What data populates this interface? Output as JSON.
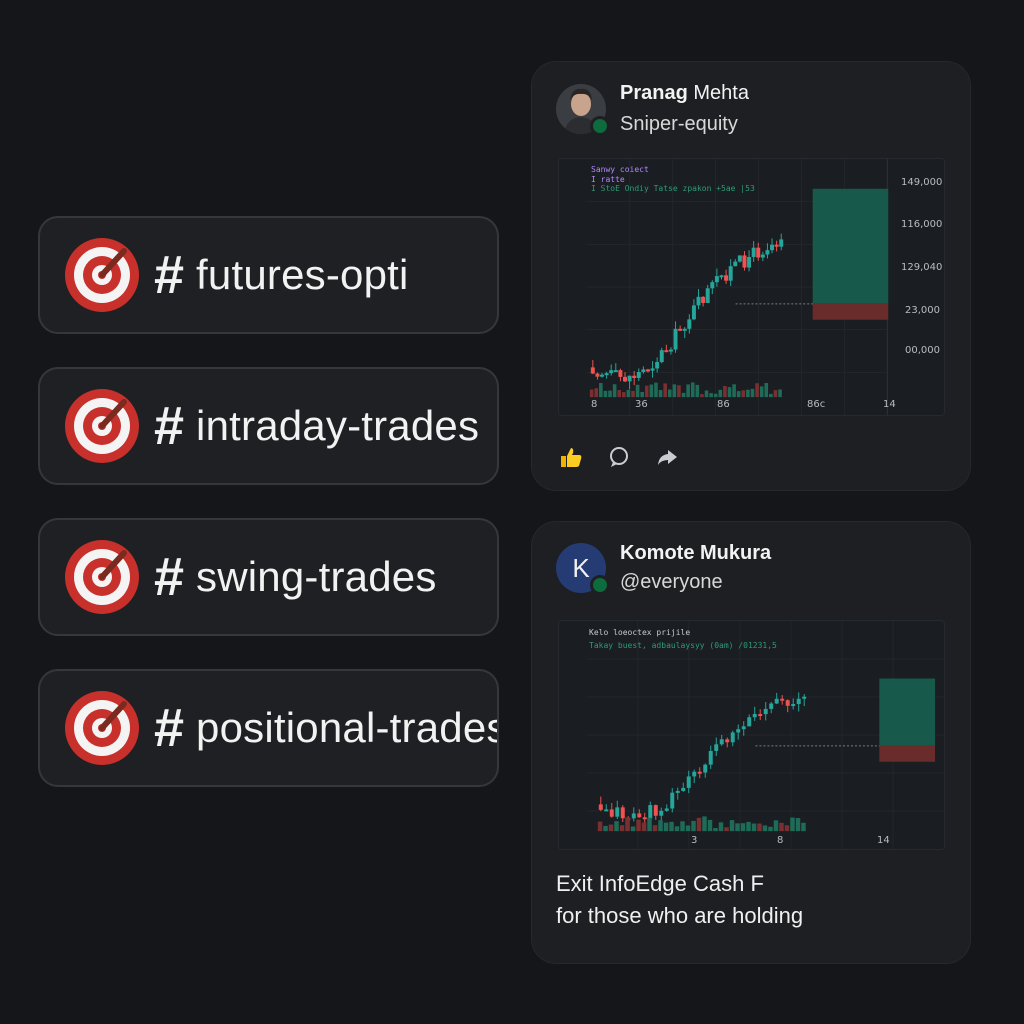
{
  "channels": [
    {
      "icon": "target-icon",
      "hash": "#",
      "name": "futures-opti"
    },
    {
      "icon": "target-icon",
      "hash": "#",
      "name": "intraday-trades"
    },
    {
      "icon": "target-icon",
      "hash": "#",
      "name": "swing-trades"
    },
    {
      "icon": "target-icon",
      "hash": "#",
      "name": "positional-trades"
    }
  ],
  "posts": [
    {
      "author_first": "Pranag",
      "author_last": "Mehta",
      "subline": "Sniper-equity",
      "avatar": "photo",
      "chart": {
        "legend_title": "Sanwy coiect",
        "legend_line2": "I ratte",
        "legend_line3": "I StoE   Ondiy  Tatse  zpakon  +5ae  |53",
        "y_ticks": [
          "149,000",
          "116,000",
          "129,040",
          "23,000",
          "00,000"
        ],
        "x_ticks": [
          "8",
          "36",
          "86",
          "86c",
          "14"
        ]
      },
      "actions": [
        "thumbs-up-icon",
        "comment-icon",
        "share-icon"
      ]
    },
    {
      "author": "Komote Mukura",
      "subline": "@everyone",
      "avatar_letter": "K",
      "chart": {
        "legend_title": "Kelo loeoctex prijile",
        "legend_line2": "Takay buest, adbaulaysyy (0am) /01231,5",
        "x_ticks": [
          "3",
          "8",
          "14"
        ]
      },
      "text_line1": "Exit InfoEdge Cash F",
      "text_line2": "for those who are holding"
    }
  ],
  "colors": {
    "background": "#151619",
    "card": "#1d1f22",
    "bull": "#26a69a",
    "bear": "#ef5350",
    "online": "#0d6b3d"
  }
}
